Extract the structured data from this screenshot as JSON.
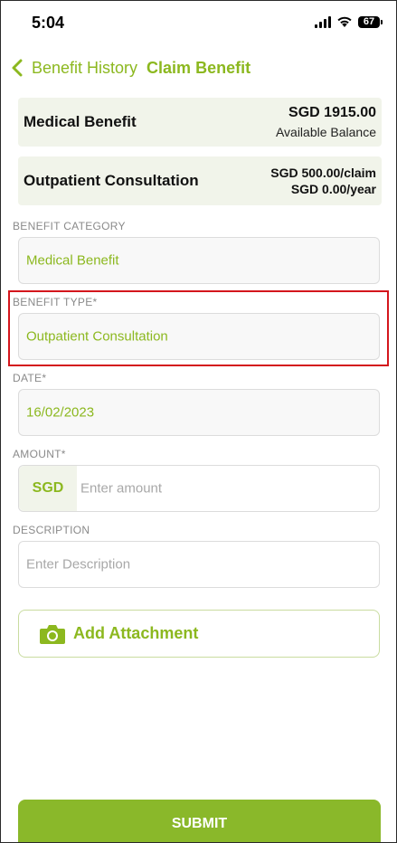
{
  "status_bar": {
    "time": "5:04",
    "battery": "67"
  },
  "header": {
    "back_label": "Benefit History",
    "title": "Claim Benefit"
  },
  "balances": [
    {
      "name": "Medical Benefit",
      "amount": "SGD 1915.00",
      "sub": "Available Balance"
    },
    {
      "name": "Outpatient Consultation",
      "per_claim": "SGD 500.00/claim",
      "per_year": "SGD 0.00/year"
    }
  ],
  "form": {
    "benefit_category": {
      "label": "BENEFIT CATEGORY",
      "value": "Medical Benefit"
    },
    "benefit_type": {
      "label": "BENEFIT TYPE*",
      "value": "Outpatient Consultation"
    },
    "date": {
      "label": "DATE*",
      "value": "16/02/2023"
    },
    "amount": {
      "label": "AMOUNT*",
      "currency": "SGD",
      "placeholder": "Enter amount"
    },
    "description": {
      "label": "DESCRIPTION",
      "placeholder": "Enter Description"
    }
  },
  "add_attachment_label": "Add Attachment",
  "submit_label": "SUBMIT",
  "colors": {
    "accent": "#8cb81f",
    "submit_bg": "#8ab82a",
    "card_bg": "#f1f4ea",
    "highlight": "#d4161c"
  },
  "icons": {
    "back": "chevron-left-icon",
    "attachment": "camera-icon",
    "signal": "signal-icon",
    "wifi": "wifi-icon",
    "battery": "battery-icon"
  }
}
